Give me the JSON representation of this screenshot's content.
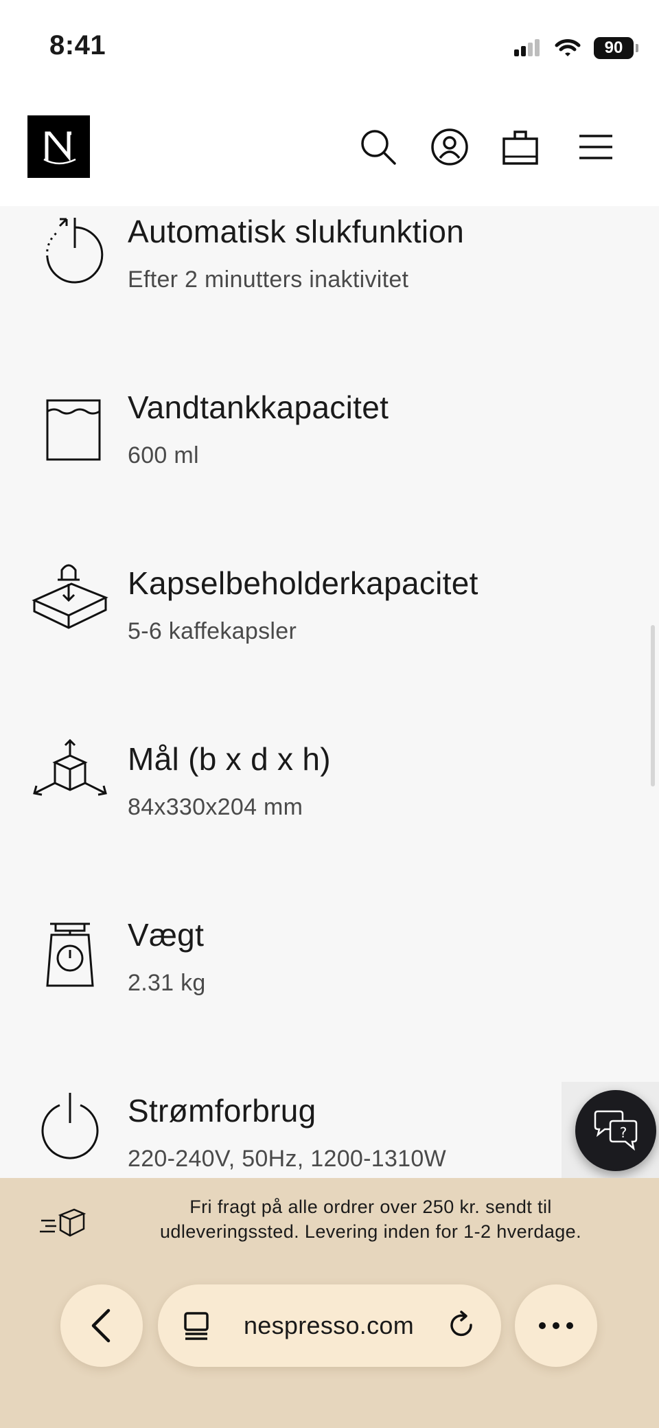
{
  "status_bar": {
    "time": "8:41",
    "battery": "90"
  },
  "header": {
    "logo_letter": "N",
    "icons": [
      "search-icon",
      "account-icon",
      "bag-icon",
      "menu-icon"
    ]
  },
  "specs": [
    {
      "icon": "auto-off-icon",
      "title": "Automatisk slukfunktion",
      "value": "Efter 2 minutters inaktivitet"
    },
    {
      "icon": "water-tank-icon",
      "title": "Vandtankkapacitet",
      "value": "600 ml"
    },
    {
      "icon": "capsule-container-icon",
      "title": "Kapselbeholderkapacitet",
      "value": "5-6 kaffekapsler"
    },
    {
      "icon": "dimensions-icon",
      "title": "Mål (b x d x h)",
      "value": "84x330x204 mm"
    },
    {
      "icon": "scale-icon",
      "title": "Vægt",
      "value": "2.31 kg"
    },
    {
      "icon": "power-icon",
      "title": "Strømforbrug",
      "value": "220-240V, 50Hz, 1200-1310W"
    }
  ],
  "chat": {
    "icon": "chat-help-icon"
  },
  "delivery": {
    "icon": "delivery-box-icon",
    "line1": "Fri fragt på alle ordrer over 250 kr. sendt til",
    "line2": "udleveringssted. Levering inden for 1-2 hverdage."
  },
  "browser": {
    "url": "nespresso.com",
    "icons": [
      "back-icon",
      "page-icon",
      "reload-icon",
      "more-icon"
    ]
  }
}
